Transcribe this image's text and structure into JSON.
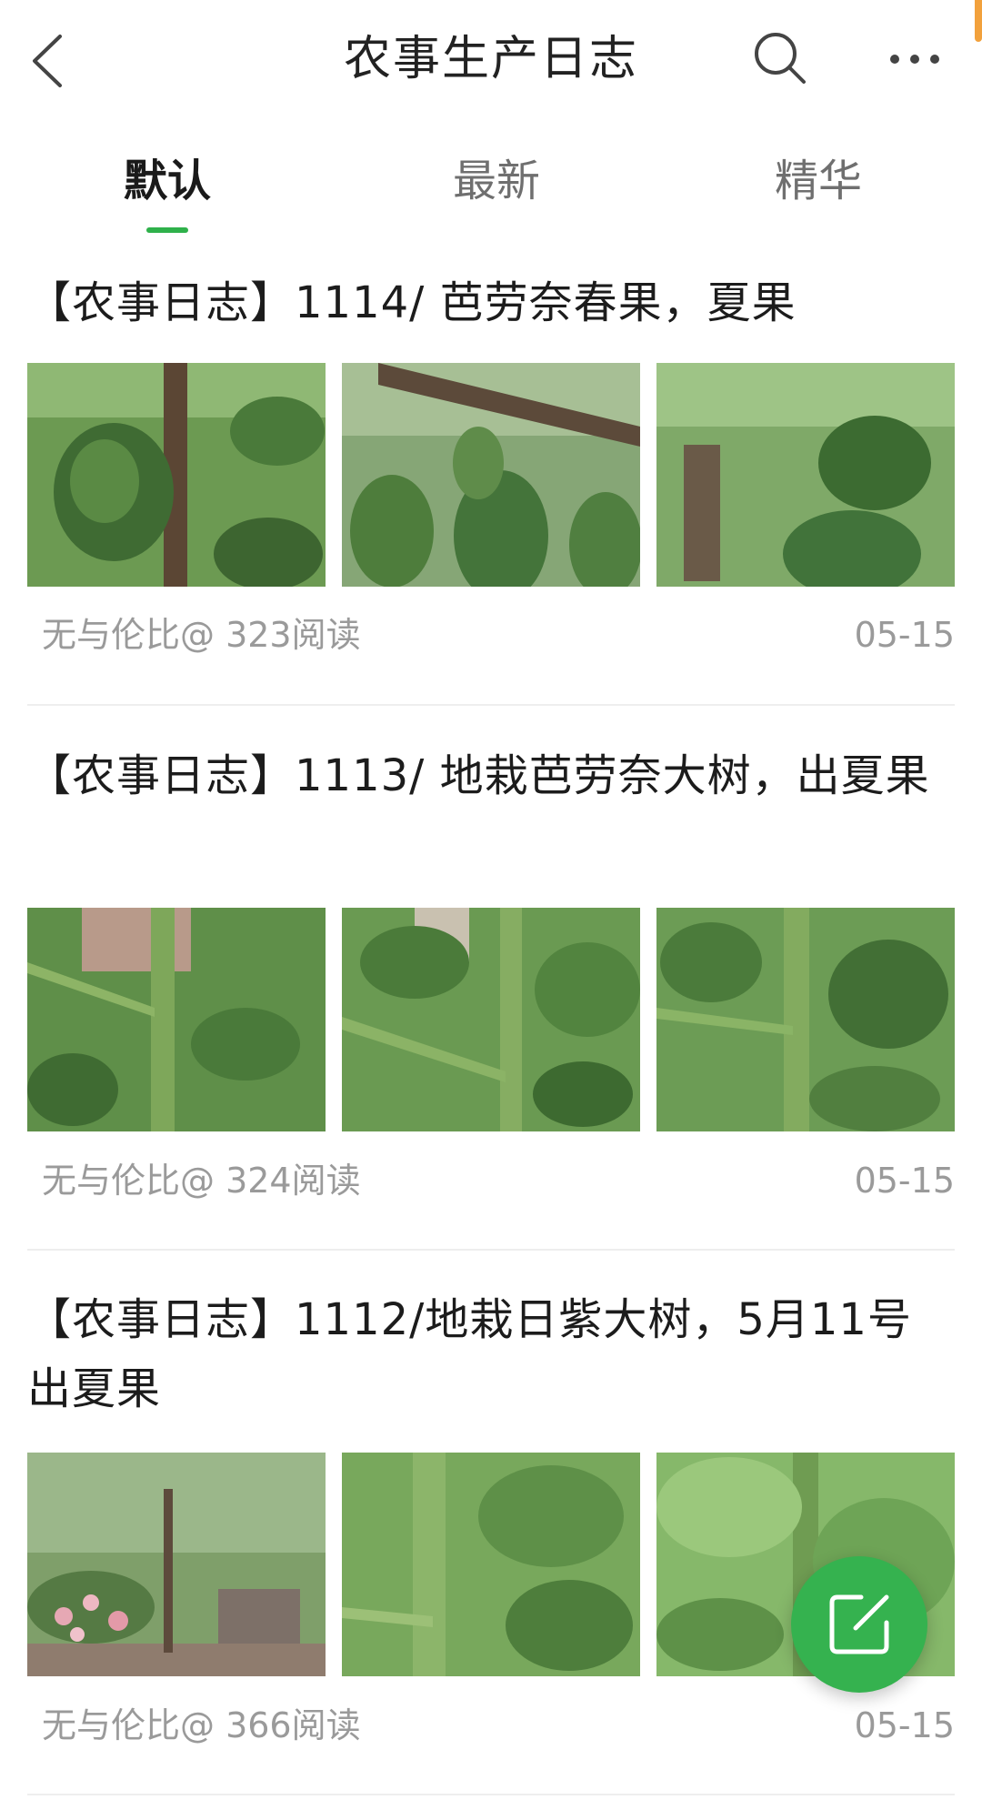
{
  "header": {
    "title": "农事生产日志",
    "back_icon": "chevron-left-icon",
    "search_icon": "search-icon",
    "more_icon": "more-horizontal-icon"
  },
  "tabs": [
    {
      "label": "默认",
      "active": true
    },
    {
      "label": "最新",
      "active": false
    },
    {
      "label": "精华",
      "active": false
    }
  ],
  "colors": {
    "accent_green": "#2fb14b",
    "fab_green": "#35b24f",
    "meta_gray": "#9a9a9a",
    "scroll_accent": "#f2a13c"
  },
  "posts": [
    {
      "title": "【农事日志】1114/ 芭劳奈春果，夏果",
      "author_reads": "无与伦比@ 323阅读",
      "date": "05-15",
      "images": [
        "fig-fruit-photo",
        "fig-fruit-photo",
        "fig-fruit-photo"
      ]
    },
    {
      "title": "【农事日志】1113/ 地栽芭劳奈大树，出夏果",
      "author_reads": "无与伦比@ 324阅读",
      "date": "05-15",
      "images": [
        "fig-branch-photo",
        "fig-branch-photo",
        "fig-branch-photo"
      ]
    },
    {
      "title": "【农事日志】1112/地栽日紫大树，5月11号出夏果",
      "author_reads": "无与伦比@ 366阅读",
      "date": "05-15",
      "images": [
        "fig-tree-garden-photo",
        "fig-branch-photo",
        "fig-leaf-photo"
      ]
    }
  ],
  "fab": {
    "icon": "compose-icon"
  }
}
